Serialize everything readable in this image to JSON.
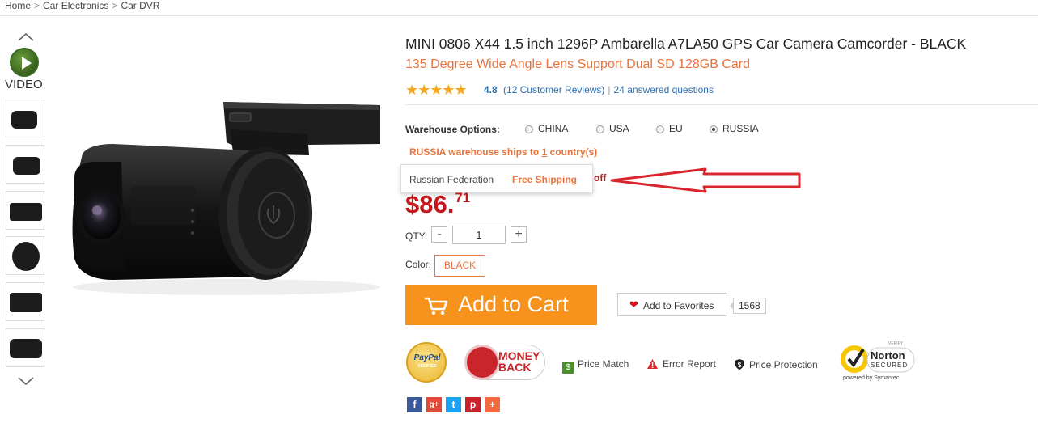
{
  "breadcrumb": [
    "Home",
    "Car Electronics",
    "Car DVR"
  ],
  "thumbnails": {
    "video_label": "VIDEO",
    "items": [
      "thumb-1",
      "thumb-2",
      "thumb-3",
      "thumb-4",
      "thumb-5",
      "thumb-6"
    ]
  },
  "product": {
    "title": "MINI 0806 X44 1.5 inch 1296P Ambarella A7LA50 GPS Car Camera Camcorder  -  BLACK",
    "subtitle": "135 Degree Wide Angle Lens Support Dual SD 128GB Card",
    "stars": "★★★★★",
    "rating_value": "4.8",
    "reviews": "(12 Customer Reviews)",
    "answered": "24 answered questions"
  },
  "warehouse": {
    "label": "Warehouse Options:",
    "options": [
      "CHINA",
      "USA",
      "EU",
      "RUSSIA"
    ],
    "selected": "RUSSIA",
    "ship_note_prefix": "RUSSIA warehouse ships to ",
    "ship_note_count": "1",
    "ship_note_suffix": " country(s)",
    "popup_country": "Russian Federation",
    "popup_shipping": "Free Shipping",
    "off_text": "off"
  },
  "price": {
    "main": "$86.",
    "cents": "71"
  },
  "quantity": {
    "label": "QTY:",
    "minus": "-",
    "value": "1",
    "plus": "+"
  },
  "color": {
    "label": "Color:",
    "selected": "BLACK"
  },
  "actions": {
    "add_to_cart": "Add to Cart",
    "add_to_favorites": "Add to Favorites",
    "favorites_count": "1568"
  },
  "badges": {
    "paypal": "PayPal",
    "paypal_sub": "VERIFIED",
    "money_back_line1": "MONEY",
    "money_back_line2": "BACK",
    "price_match": "Price Match",
    "error_report": "Error Report",
    "price_protection": "Price Protection",
    "norton_top": "VERIFY",
    "norton_name": "Norton",
    "norton_secured": "SECURED",
    "norton_powered": "powered by Symantec"
  },
  "social": [
    "f",
    "g+",
    "t",
    "p",
    "+"
  ],
  "colors": {
    "orange": "#e8733c",
    "cart_orange": "#f7931d",
    "price_red": "#c4171c",
    "link_blue": "#2a6fb2"
  }
}
